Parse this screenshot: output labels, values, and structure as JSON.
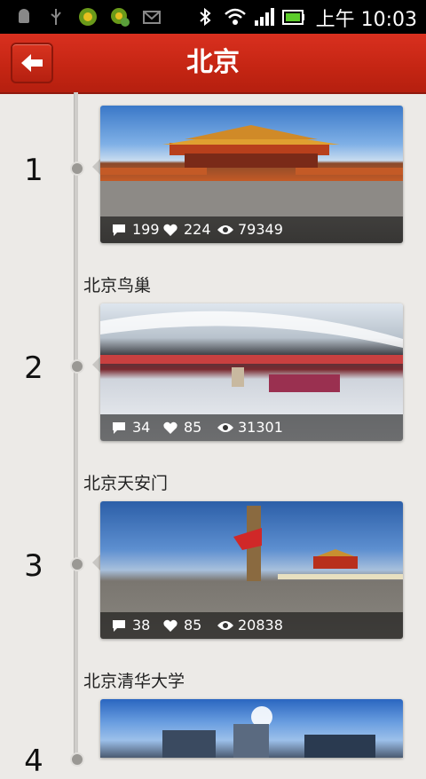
{
  "status_bar": {
    "time": "上午 10:03",
    "icons": [
      "android-icon",
      "usb-icon",
      "app-icon",
      "app-check-icon",
      "mail-icon",
      "bluetooth-icon",
      "wifi-icon",
      "signal-icon",
      "battery-icon"
    ]
  },
  "header": {
    "title": "北京",
    "back_icon": "back-arrow-icon"
  },
  "items": [
    {
      "number": "1",
      "label": "",
      "comments": "199",
      "likes": "224",
      "views": "79349"
    },
    {
      "number": "2",
      "label": "北京鸟巢",
      "comments": "34",
      "likes": "85",
      "views": "31301"
    },
    {
      "number": "3",
      "label": "北京天安门",
      "comments": "38",
      "likes": "85",
      "views": "20838"
    },
    {
      "number": "4",
      "label": "北京清华大学"
    }
  ],
  "colors": {
    "header": "#c42513",
    "background": "#eceae7",
    "stats_bar": "rgba(0,0,0,0.55)"
  }
}
